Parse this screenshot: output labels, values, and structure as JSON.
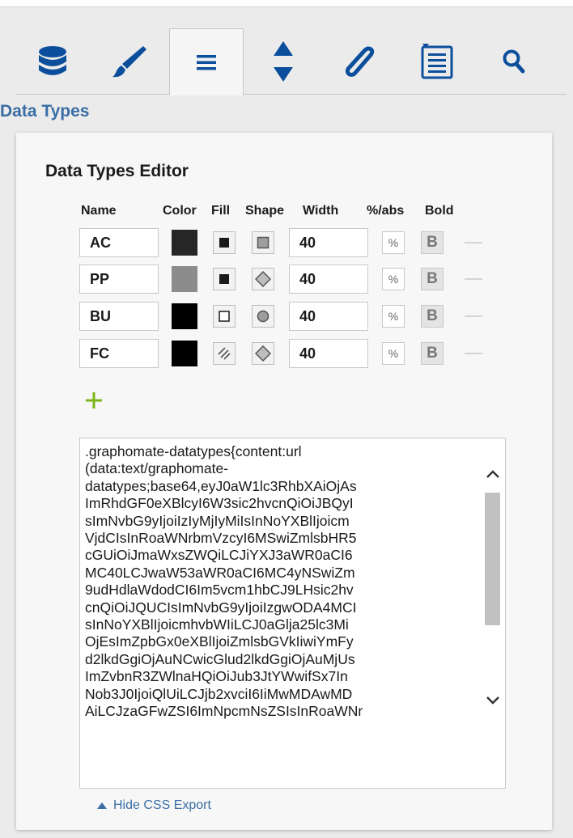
{
  "section_title": "Data Types",
  "tabs": [
    {
      "icon": "database-icon"
    },
    {
      "icon": "brush-icon"
    },
    {
      "icon": "menu-icon",
      "active": true
    },
    {
      "icon": "sort-icon"
    },
    {
      "icon": "paperclip-icon"
    },
    {
      "icon": "list-icon"
    },
    {
      "icon": "search-icon"
    }
  ],
  "editor": {
    "title": "Data Types Editor",
    "columns": {
      "name": "Name",
      "color": "Color",
      "fill": "Fill",
      "shape": "Shape",
      "width": "Width",
      "pct_abs": "%/abs",
      "bold": "Bold"
    },
    "rows": [
      {
        "name": "AC",
        "color": "#262626",
        "fill": "solid",
        "shape": "square",
        "width": "40",
        "pct": "%",
        "bold": "B"
      },
      {
        "name": "PP",
        "color": "#8c8c8c",
        "fill": "solid",
        "shape": "diamond",
        "width": "40",
        "pct": "%",
        "bold": "B"
      },
      {
        "name": "BU",
        "color": "#000000",
        "fill": "empty",
        "shape": "circle",
        "width": "40",
        "pct": "%",
        "bold": "B"
      },
      {
        "name": "FC",
        "color": "#000000",
        "fill": "hatched",
        "shape": "diamond",
        "width": "40",
        "pct": "%",
        "bold": "B"
      }
    ],
    "css_export_text": ".graphomate-datatypes{content:url\n(data:text/graphomate-\ndatatypes;base64,eyJ0aW1lc3RhbXAiOjAs\nImRhdGF0eXBlcyI6W3sic2hvcnQiOiJBQyI\nsImNvbG9yIjoiIzIyMjIyMiIsInNoYXBlIjoicm\nVjdCIsInRoaWNrbmVzcyI6MSwiZmlsbHR5\ncGUiOiJmaWxsZWQiLCJiYXJ3aWR0aCI6\nMC40LCJwaW53aWR0aCI6MC4yNSwiZm\n9udHdlaWdodCI6Im5vcm1hbCJ9LHsic2hv\ncnQiOiJQUCIsImNvbG9yIjoiIzgwODA4MCI\nsInNoYXBlIjoicmhvbWIiLCJ0aGlja25lc3Mi\nOjEsImZpbGx0eXBlIjoiZmlsbGVkIiwiYmFy\nd2lkdGgiOjAuNCwicGlud2lkdGgiOjAuMjUs\nImZvbnR3ZWlnaHQiOiJub3JtYWwifSx7In\nNob3J0IjoiQlUiLCJjb2xvciI6IiMwMDAwMD\nAiLCJzaGFwZSI6ImNpcmNsZSIsInRoaWNr",
    "hide_css_label": "Hide CSS Export"
  },
  "colors": {
    "accent": "#3a6ea5",
    "add": "#7cb518"
  }
}
